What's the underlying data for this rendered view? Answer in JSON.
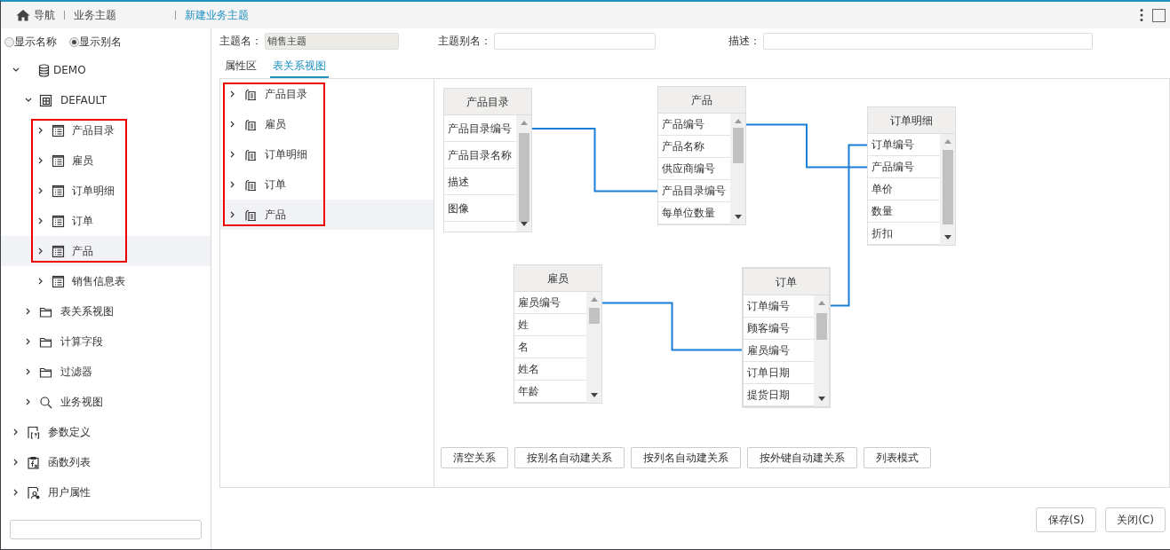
{
  "breadcrumb": [
    {
      "label": "导航",
      "kind": "home"
    },
    {
      "label": "业务主题",
      "kind": "link"
    },
    {
      "label": "新建业务主题",
      "kind": "current"
    }
  ],
  "display_mode": [
    {
      "label": "显示名称",
      "selected": false
    },
    {
      "label": "显示别名",
      "selected": true
    }
  ],
  "tree": [
    {
      "label": "DEMO",
      "kind": "database",
      "expanded": true,
      "selected": false,
      "children": [
        {
          "label": "DEFAULT",
          "kind": "schema",
          "expanded": true,
          "selected": false,
          "children": [
            {
              "label": "产品目录",
              "kind": "table",
              "expanded": false,
              "selected": false,
              "framed": true
            },
            {
              "label": "雇员",
              "kind": "table",
              "expanded": false,
              "selected": false,
              "framed": true
            },
            {
              "label": "订单明细",
              "kind": "table",
              "expanded": false,
              "selected": false,
              "framed": true
            },
            {
              "label": "订单",
              "kind": "table",
              "expanded": false,
              "selected": false,
              "framed": true
            },
            {
              "label": "产品",
              "kind": "table",
              "expanded": false,
              "selected": true,
              "framed": true
            },
            {
              "label": "销售信息表",
              "kind": "table",
              "expanded": false,
              "selected": false,
              "framed": false
            }
          ]
        },
        {
          "label": "表关系视图",
          "kind": "folder",
          "expanded": false,
          "selected": false
        },
        {
          "label": "计算字段",
          "kind": "folder",
          "expanded": false,
          "selected": false
        },
        {
          "label": "过滤器",
          "kind": "folder",
          "expanded": false,
          "selected": false
        },
        {
          "label": "业务视图",
          "kind": "search",
          "expanded": false,
          "selected": false
        }
      ]
    },
    {
      "label": "参数定义",
      "kind": "param",
      "expanded": false,
      "selected": false
    },
    {
      "label": "函数列表",
      "kind": "function",
      "expanded": false,
      "selected": false
    },
    {
      "label": "用户属性",
      "kind": "user",
      "expanded": false,
      "selected": false
    }
  ],
  "form": [
    {
      "label": "主题名：",
      "value": "销售主题",
      "readonly": true
    },
    {
      "label": "主题别名：",
      "readonly": false
    },
    {
      "label": "描述：",
      "readonly": false
    }
  ],
  "tabs": [
    {
      "label": "属性区",
      "selected": false
    },
    {
      "label": "表关系视图",
      "selected": true
    }
  ],
  "table_list": [
    {
      "label": "产品目录",
      "expanded": false,
      "selected": false,
      "framed": true
    },
    {
      "label": "雇员",
      "expanded": false,
      "selected": false,
      "framed": true
    },
    {
      "label": "订单明细",
      "expanded": false,
      "selected": false,
      "framed": true
    },
    {
      "label": "订单",
      "expanded": false,
      "selected": false,
      "framed": true
    },
    {
      "label": "产品",
      "expanded": false,
      "selected": true,
      "framed": true
    }
  ],
  "diagram": {
    "tables": [
      {
        "title": "产品目录",
        "fields": [
          "产品目录编号",
          "产品目录名称",
          "描述",
          "图像"
        ]
      },
      {
        "title": "产品",
        "fields": [
          "产品编号",
          "产品名称",
          "供应商编号",
          "产品目录编号",
          "每单位数量"
        ]
      },
      {
        "title": "订单明细",
        "fields": [
          "订单编号",
          "产品编号",
          "单价",
          "数量",
          "折扣"
        ]
      },
      {
        "title": "雇员",
        "fields": [
          "雇员编号",
          "姓",
          "名",
          "姓名",
          "年龄"
        ]
      },
      {
        "title": "订单",
        "fields": [
          "订单编号",
          "顾客编号",
          "雇员编号",
          "订单日期",
          "提货日期"
        ]
      }
    ]
  },
  "diagram_buttons": [
    "清空关系",
    "按别名自动建关系",
    "按列名自动建关系",
    "按外键自动建关系",
    "列表模式"
  ],
  "footer_buttons": [
    "保存(S)",
    "关闭(C)"
  ]
}
